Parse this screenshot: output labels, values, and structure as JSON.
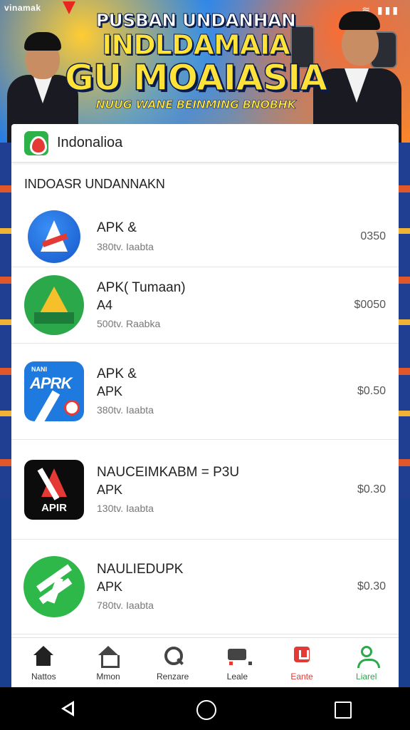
{
  "banner": {
    "brand": "vinamak",
    "status_icons": "wifi signal battery",
    "line1": "PUSBAN UNDANHAN",
    "line2": "INDLDAMAIA",
    "line3": "GU MOAIASIA",
    "line4": "NUUG WANE BEINMING BNOBHK",
    "accent": "#ffe23a"
  },
  "card": {
    "title": "Indonalioa",
    "section_title": "INDOASR UNDANNAKN"
  },
  "apps": [
    {
      "name": "APK &",
      "sub": "",
      "meta": "380tv. Iaabta",
      "price": "0350",
      "icon": "apk-blue-circle-icon"
    },
    {
      "name": "APK( Tumaan)",
      "sub": "A4",
      "meta": "500tv. Raabka",
      "price": "$0050",
      "icon": "apk-green-triangle-icon"
    },
    {
      "name": "APK &",
      "sub": "APK",
      "meta": "380tv. Iaabta",
      "price": "$0.50",
      "icon": "apk-blue-square-icon"
    },
    {
      "name": "NAUCEIMKABM = P3U",
      "sub": "APK",
      "meta": "130tv. Iaabta",
      "price": "$0.30",
      "icon": "apk-black-square-icon"
    },
    {
      "name": "NAULIEDUPK",
      "sub": "APK",
      "meta": "780tv. Iaabta",
      "price": "$0.30",
      "icon": "apk-green-circle-icon"
    }
  ],
  "tabs": [
    {
      "label": "Nattos",
      "icon": "home-filled-icon"
    },
    {
      "label": "Mmon",
      "icon": "home-outline-icon"
    },
    {
      "label": "Renzare",
      "icon": "search-icon"
    },
    {
      "label": "Leale",
      "icon": "cart-icon"
    },
    {
      "label": "Eante",
      "icon": "bag-icon"
    },
    {
      "label": "Liarel",
      "icon": "user-icon"
    }
  ],
  "colors": {
    "primary_red": "#e53935",
    "primary_green": "#2ba84a",
    "blue": "#1557c9"
  }
}
